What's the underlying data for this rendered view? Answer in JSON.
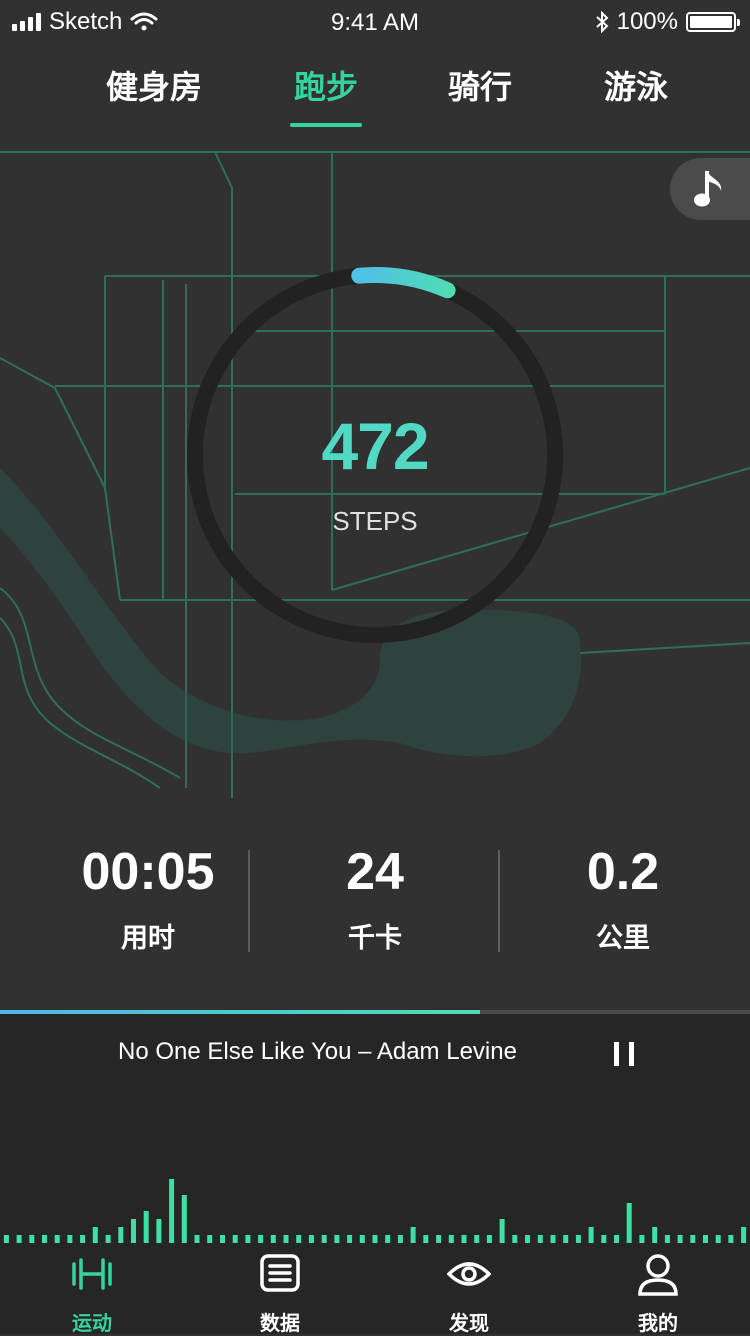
{
  "status_bar": {
    "carrier": "Sketch",
    "time": "9:41 AM",
    "battery": "100%"
  },
  "tabs": [
    {
      "label": "健身房",
      "active": false
    },
    {
      "label": "跑步",
      "active": true
    },
    {
      "label": "骑行",
      "active": false
    },
    {
      "label": "游泳",
      "active": false
    }
  ],
  "steps": {
    "value": "472",
    "label": "STEPS",
    "progress": 0.08
  },
  "stats": [
    {
      "value": "00:05",
      "label": "用时"
    },
    {
      "value": "24",
      "label": "千卡"
    },
    {
      "value": "0.2",
      "label": "公里"
    }
  ],
  "player": {
    "song": "No One Else Like You – Adam Levine",
    "progress": 0.64
  },
  "tabbar": [
    {
      "label": "运动",
      "icon": "dumbbell-icon",
      "active": true
    },
    {
      "label": "数据",
      "icon": "list-icon",
      "active": false
    },
    {
      "label": "发现",
      "icon": "eye-icon",
      "active": false
    },
    {
      "label": "我的",
      "icon": "user-icon",
      "active": false
    }
  ],
  "colors": {
    "accent": "#35d3a0",
    "steps": "#50dac4",
    "background": "#313131",
    "player": "#262626"
  },
  "visualizer_levels": [
    1,
    1,
    1,
    1,
    1,
    1,
    1,
    2,
    1,
    2,
    3,
    4,
    3,
    8,
    6,
    1,
    1,
    1,
    1,
    1,
    1,
    1,
    1,
    1,
    1,
    1,
    1,
    1,
    1,
    1,
    1,
    1,
    2,
    1,
    1,
    1,
    1,
    1,
    1,
    3,
    1,
    1,
    1,
    1,
    1,
    1,
    2,
    1,
    1,
    5,
    1,
    2,
    1,
    1,
    1,
    1,
    1,
    1,
    2
  ]
}
